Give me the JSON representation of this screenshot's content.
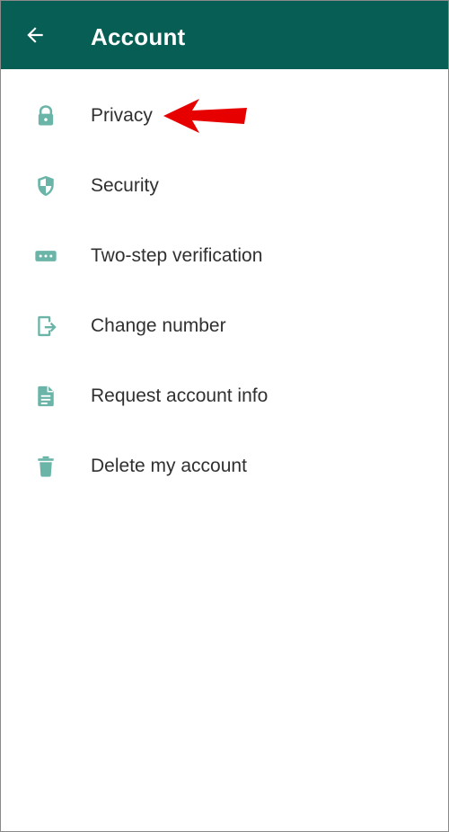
{
  "header": {
    "title": "Account",
    "back_icon": "arrow-left-icon"
  },
  "menu": {
    "items": [
      {
        "label": "Privacy",
        "icon": "lock-icon"
      },
      {
        "label": "Security",
        "icon": "shield-icon"
      },
      {
        "label": "Two-step verification",
        "icon": "password-dots-icon"
      },
      {
        "label": "Change number",
        "icon": "phone-transfer-icon"
      },
      {
        "label": "Request account info",
        "icon": "document-icon"
      },
      {
        "label": "Delete my account",
        "icon": "trash-icon"
      }
    ]
  },
  "colors": {
    "app_bar": "#075e54",
    "icon": "#6ab5a8",
    "text": "#303030",
    "annotation": "#e60000"
  },
  "annotation": {
    "icon": "red-arrow-icon"
  }
}
